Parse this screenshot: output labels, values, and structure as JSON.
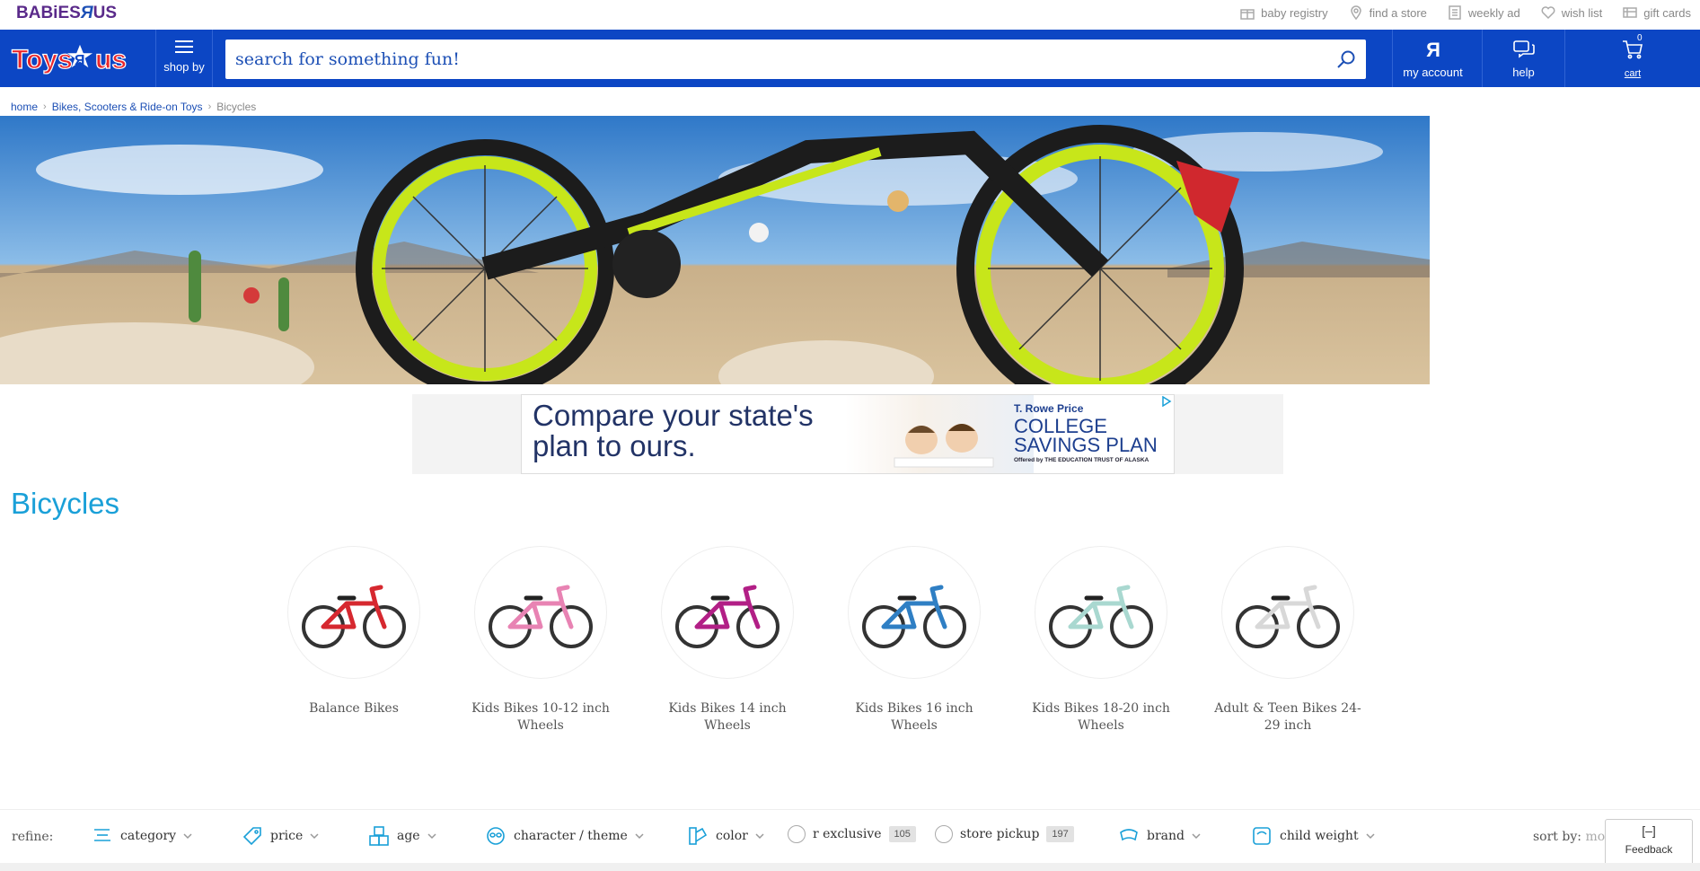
{
  "utility": {
    "babies_logo": "BABiES",
    "babies_logo_r": "Я",
    "babies_logo_us": "US",
    "links": [
      {
        "label": "baby registry",
        "icon": "gift-icon"
      },
      {
        "label": "find a store",
        "icon": "map-pin-icon"
      },
      {
        "label": "weekly ad",
        "icon": "document-icon"
      },
      {
        "label": "wish list",
        "icon": "heart-icon"
      },
      {
        "label": "gift cards",
        "icon": "gift-card-icon"
      }
    ]
  },
  "header": {
    "shop_by": "shop by",
    "search_placeholder": "search for something fun!",
    "my_account": "my account",
    "help": "help",
    "cart": "cart",
    "cart_count": "0"
  },
  "breadcrumb": {
    "home": "home",
    "parent": "Bikes, Scooters & Ride-on Toys",
    "current": "Bicycles"
  },
  "ad": {
    "headline": "Compare your state's plan to ours.",
    "brand_top": "T. Rowe Price",
    "brand_main": "COLLEGE SAVINGS PLAN",
    "brand_sub": "Offered by THE EDUCATION TRUST OF ALASKA"
  },
  "page_title": "Bicycles",
  "categories": [
    {
      "label": "Balance Bikes",
      "frame_color": "#d6282f"
    },
    {
      "label": "Kids Bikes 10-12 inch Wheels",
      "frame_color": "#e883b3"
    },
    {
      "label": "Kids Bikes 14 inch Wheels",
      "frame_color": "#b21f86"
    },
    {
      "label": "Kids Bikes 16 inch Wheels",
      "frame_color": "#2f7fc4"
    },
    {
      "label": "Kids Bikes 18-20 inch Wheels",
      "frame_color": "#a9d8d0"
    },
    {
      "label": "Adult & Teen Bikes 24-29 inch",
      "frame_color": "#d8d8d8"
    }
  ],
  "refine": {
    "label": "refine:",
    "items": [
      {
        "label": "category",
        "icon": "category-icon"
      },
      {
        "label": "price",
        "icon": "price-tag-icon"
      },
      {
        "label": "age",
        "icon": "blocks-icon"
      },
      {
        "label": "character / theme",
        "icon": "mask-icon"
      },
      {
        "label": "color",
        "icon": "swatch-icon"
      },
      {
        "label": "r exclusive",
        "count": "105"
      },
      {
        "label": "store pickup",
        "count": "197"
      },
      {
        "label": "brand",
        "icon": "brand-icon"
      },
      {
        "label": "child weight",
        "icon": "scale-icon"
      }
    ],
    "sort_label": "sort by:",
    "sort_value": "most relevant"
  },
  "feedback": {
    "icon": "[–]",
    "label": "Feedback"
  },
  "colors": {
    "header_blue": "#0c46c4",
    "accent": "#1aa0d8"
  }
}
